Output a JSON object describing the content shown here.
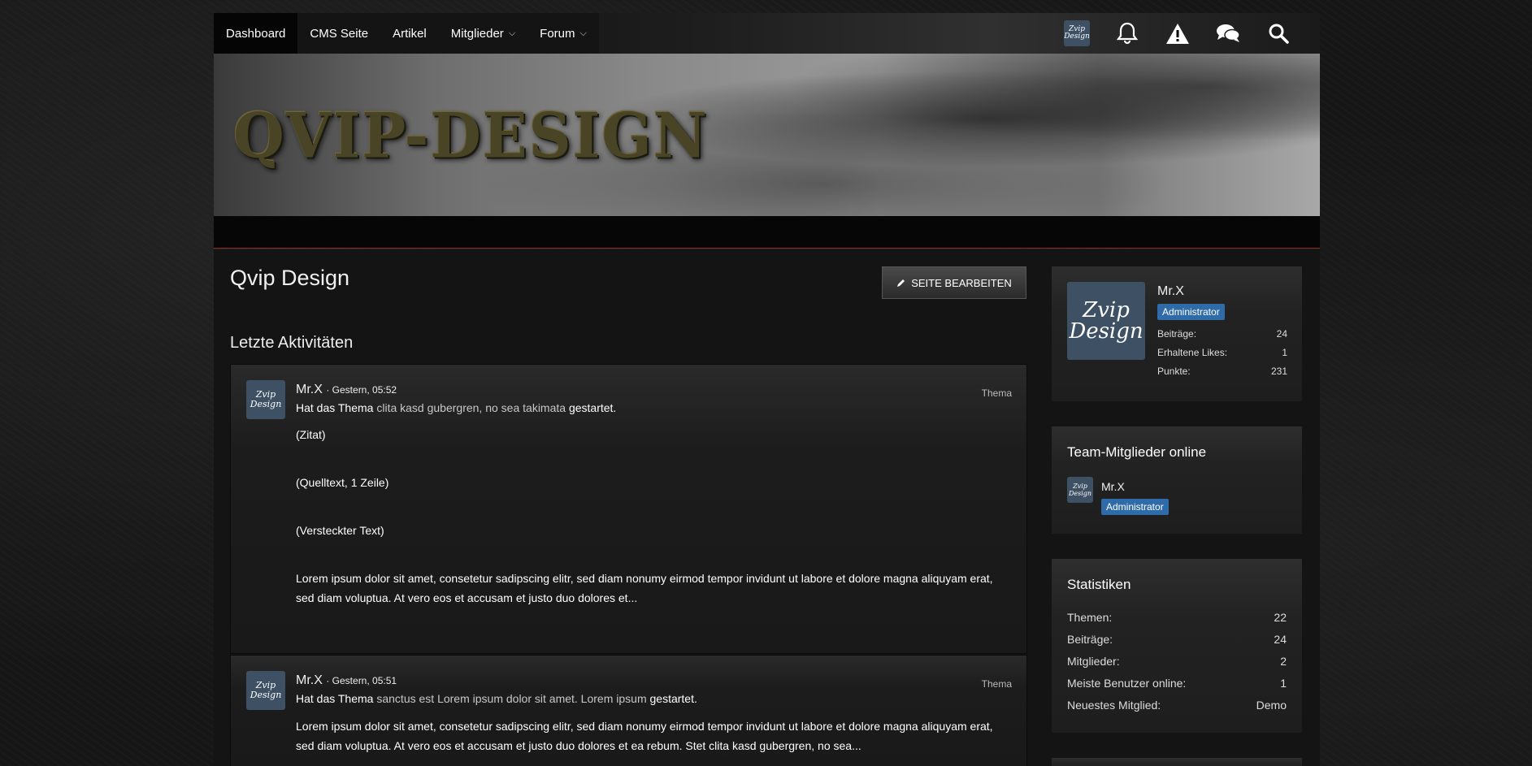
{
  "nav": {
    "items": [
      {
        "label": "Dashboard",
        "active": true
      },
      {
        "label": "CMS Seite"
      },
      {
        "label": "Artikel"
      },
      {
        "label": "Mitglieder",
        "dropdown": true
      },
      {
        "label": "Forum",
        "dropdown": true
      }
    ],
    "icons": [
      "user-avatar",
      "bell-icon",
      "warning-icon",
      "comments-icon",
      "search-icon"
    ]
  },
  "banner": {
    "title": "QVIP-DESIGN"
  },
  "avatar_text": {
    "line1": "Zvip",
    "line2": "Design"
  },
  "page": {
    "title": "Qvip Design",
    "edit_button": "SEITE BEARBEITEN",
    "section_title": "Letzte Aktivitäten"
  },
  "activities": [
    {
      "user": "Mr.X",
      "time": "· Gestern, 05:52",
      "type": "Thema",
      "action_prefix": "Hat das Thema",
      "topic": "clita kasd gubergren, no sea takimata",
      "action_suffix": "gestartet.",
      "body": [
        "(Zitat)",
        "(Quelltext, 1 Zeile)",
        "(Versteckter Text)",
        "Lorem ipsum dolor sit amet, consetetur sadipscing elitr, sed diam nonumy eirmod tempor invidunt ut labore et dolore magna aliquyam erat, sed diam voluptua. At vero eos et accusam et justo duo dolores et..."
      ]
    },
    {
      "user": "Mr.X",
      "time": "· Gestern, 05:51",
      "type": "Thema",
      "action_prefix": "Hat das Thema",
      "topic": "sanctus est Lorem ipsum dolor sit amet. Lorem ipsum",
      "action_suffix": "gestartet.",
      "body": [
        "Lorem ipsum dolor sit amet, consetetur sadipscing elitr, sed diam nonumy eirmod tempor invidunt ut labore et dolore magna aliquyam erat, sed diam voluptua. At vero eos et accusam et justo duo dolores et ea rebum. Stet clita kasd gubergren, no sea..."
      ]
    }
  ],
  "user_box": {
    "name": "Mr.X",
    "badge": "Administrator",
    "stats": [
      {
        "label": "Beiträge:",
        "value": "24"
      },
      {
        "label": "Erhaltene Likes:",
        "value": "1"
      },
      {
        "label": "Punkte:",
        "value": "231"
      }
    ]
  },
  "team_box": {
    "title": "Team-Mitglieder online",
    "member": "Mr.X",
    "badge": "Administrator"
  },
  "stats_box": {
    "title": "Statistiken",
    "rows": [
      {
        "label": "Themen:",
        "value": "22"
      },
      {
        "label": "Beiträge:",
        "value": "24"
      },
      {
        "label": "Mitglieder:",
        "value": "2"
      },
      {
        "label": "Meiste Benutzer online:",
        "value": "1"
      },
      {
        "label": "Neuestes Mitglied:",
        "value": "Demo"
      }
    ]
  },
  "colors": {
    "accent": "#2e6ba8",
    "divider": "#8a2a2a",
    "avatar_bg": "#3d5064"
  }
}
